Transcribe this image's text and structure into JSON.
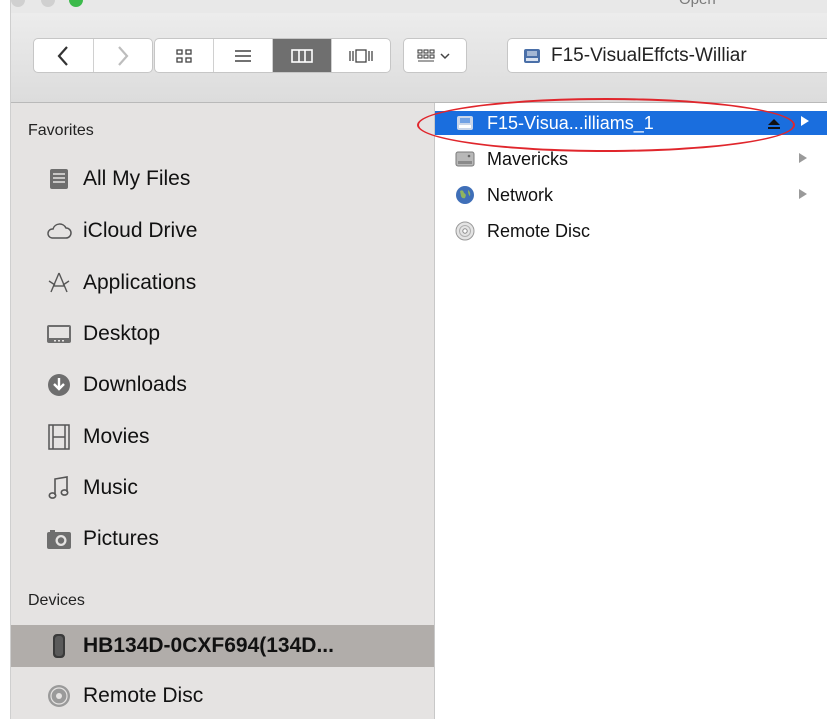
{
  "window": {
    "title": "Open",
    "traffic_lights": [
      "#d0d0d0",
      "#d0d0d0",
      "#3cba4b"
    ]
  },
  "toolbar": {
    "nav": {
      "back_icon": "chevron-left-icon",
      "forward_icon": "chevron-right-icon"
    },
    "view_modes": [
      {
        "icon": "icon-view-icon",
        "selected": false
      },
      {
        "icon": "list-view-icon",
        "selected": false
      },
      {
        "icon": "column-view-icon",
        "selected": true
      },
      {
        "icon": "cover-flow-view-icon",
        "selected": false
      }
    ],
    "arrange_icon": "arrange-grid-icon",
    "path_label": "F15-VisualEffcts-Williar"
  },
  "sidebar": {
    "favorites_heading": "Favorites",
    "favorites": [
      {
        "label": "All My Files",
        "icon": "all-my-files-icon"
      },
      {
        "label": "iCloud Drive",
        "icon": "cloud-icon"
      },
      {
        "label": "Applications",
        "icon": "applications-icon"
      },
      {
        "label": "Desktop",
        "icon": "desktop-icon"
      },
      {
        "label": "Downloads",
        "icon": "downloads-icon"
      },
      {
        "label": "Movies",
        "icon": "film-icon"
      },
      {
        "label": "Music",
        "icon": "music-note-icon"
      },
      {
        "label": "Pictures",
        "icon": "camera-icon"
      }
    ],
    "devices_heading": "Devices",
    "devices": [
      {
        "label": "HB134D-0CXF694(134D...",
        "icon": "computer-icon",
        "selected": true
      },
      {
        "label": "Remote Disc",
        "icon": "disc-icon",
        "selected": false
      }
    ]
  },
  "column": {
    "items": [
      {
        "label": "F15-Visua...illiams_1",
        "icon": "external-drive-icon",
        "selected": true,
        "ejectable": true
      },
      {
        "label": "Mavericks",
        "icon": "hard-drive-icon",
        "selected": false
      },
      {
        "label": "Network",
        "icon": "network-globe-icon",
        "selected": false
      },
      {
        "label": "Remote Disc",
        "icon": "disc-icon",
        "selected": false
      }
    ]
  },
  "colors": {
    "selection_blue": "#1a6ede",
    "sidebar_background": "#e5e3e2",
    "sidebar_selected": "#b1adaa",
    "annotation_red": "#e0262c"
  }
}
